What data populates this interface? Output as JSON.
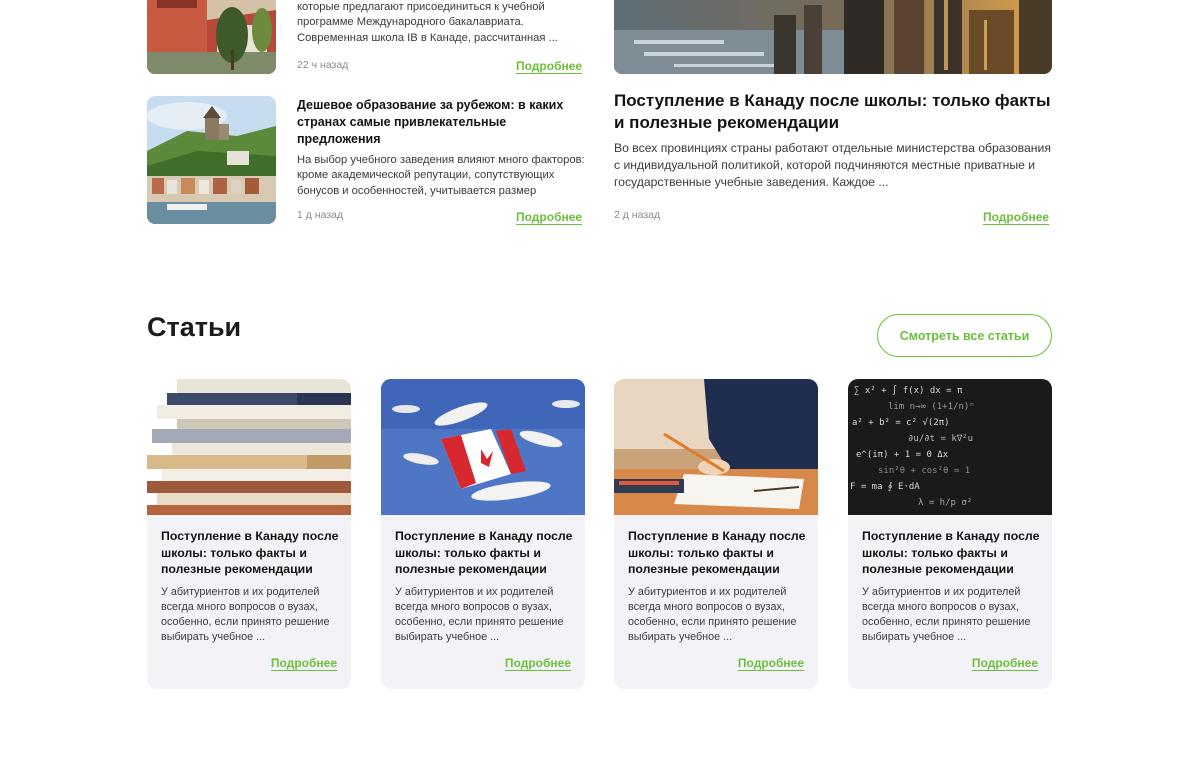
{
  "news": {
    "item1": {
      "text": "которые предлагают присоединиться к учебной программе Международного бакалавриата. Современная школа IB в Канаде, рассчитанная ...",
      "date": "22 ч назад",
      "more": "Подробнее",
      "image": "campus-building-image"
    },
    "item2": {
      "title": "Дешевое образование за рубежом: в каких странах самые привлекательные предложения",
      "text": "На выбор учебного заведения влияют много факторов: кроме академической репутации, сопутствующих бонусов и особенностей, учитывается размер",
      "date": "1 д назад",
      "more": "Подробнее",
      "image": "castle-town-image"
    },
    "featured": {
      "title": "Поступление в Канаду после школы: только факты и полезные рекомендации",
      "text": "Во всех  провинциях страны работают отдельные министерства образования с индивидуальной политикой, которой подчиняются местные приватные и государственные учебные заведения. Каждое ...",
      "date": "2 д назад",
      "more": "Подробнее",
      "image": "city-harbor-image"
    }
  },
  "articles": {
    "heading": "Статьи",
    "see_all": "Смотреть все статьи",
    "cards": [
      {
        "title": "Поступление в Канаду после школы: только факты и полезные рекомендации",
        "text": "У абитуриентов и их родителей всегда много вопросов о вузах, особенно, если принято решение выбирать учебное ...",
        "more": "Подробнее",
        "image": "books-stack-image"
      },
      {
        "title": "Поступление в Канаду после школы: только факты и полезные рекомендации",
        "text": "У абитуриентов и их родителей всегда много вопросов о вузах, особенно, если принято решение выбирать учебное ...",
        "more": "Подробнее",
        "image": "canada-flag-gulls-image"
      },
      {
        "title": "Поступление в Канаду после школы: только факты и полезные рекомендации",
        "text": "У абитуриентов и их родителей всегда много вопросов о вузах, особенно, если принято решение выбирать учебное ...",
        "more": "Подробнее",
        "image": "student-writing-image"
      },
      {
        "title": "Поступление в Канаду после школы: только факты и полезные рекомендации",
        "text": "У абитуриентов и их родителей всегда много вопросов о вузах, особенно, если принято решение выбирать учебное ...",
        "more": "Подробнее",
        "image": "math-formulas-image"
      }
    ]
  },
  "colors": {
    "accent": "#6cbf3a",
    "card_bg": "#f3f3f7",
    "text": "#141416",
    "muted": "#8a8a90"
  }
}
